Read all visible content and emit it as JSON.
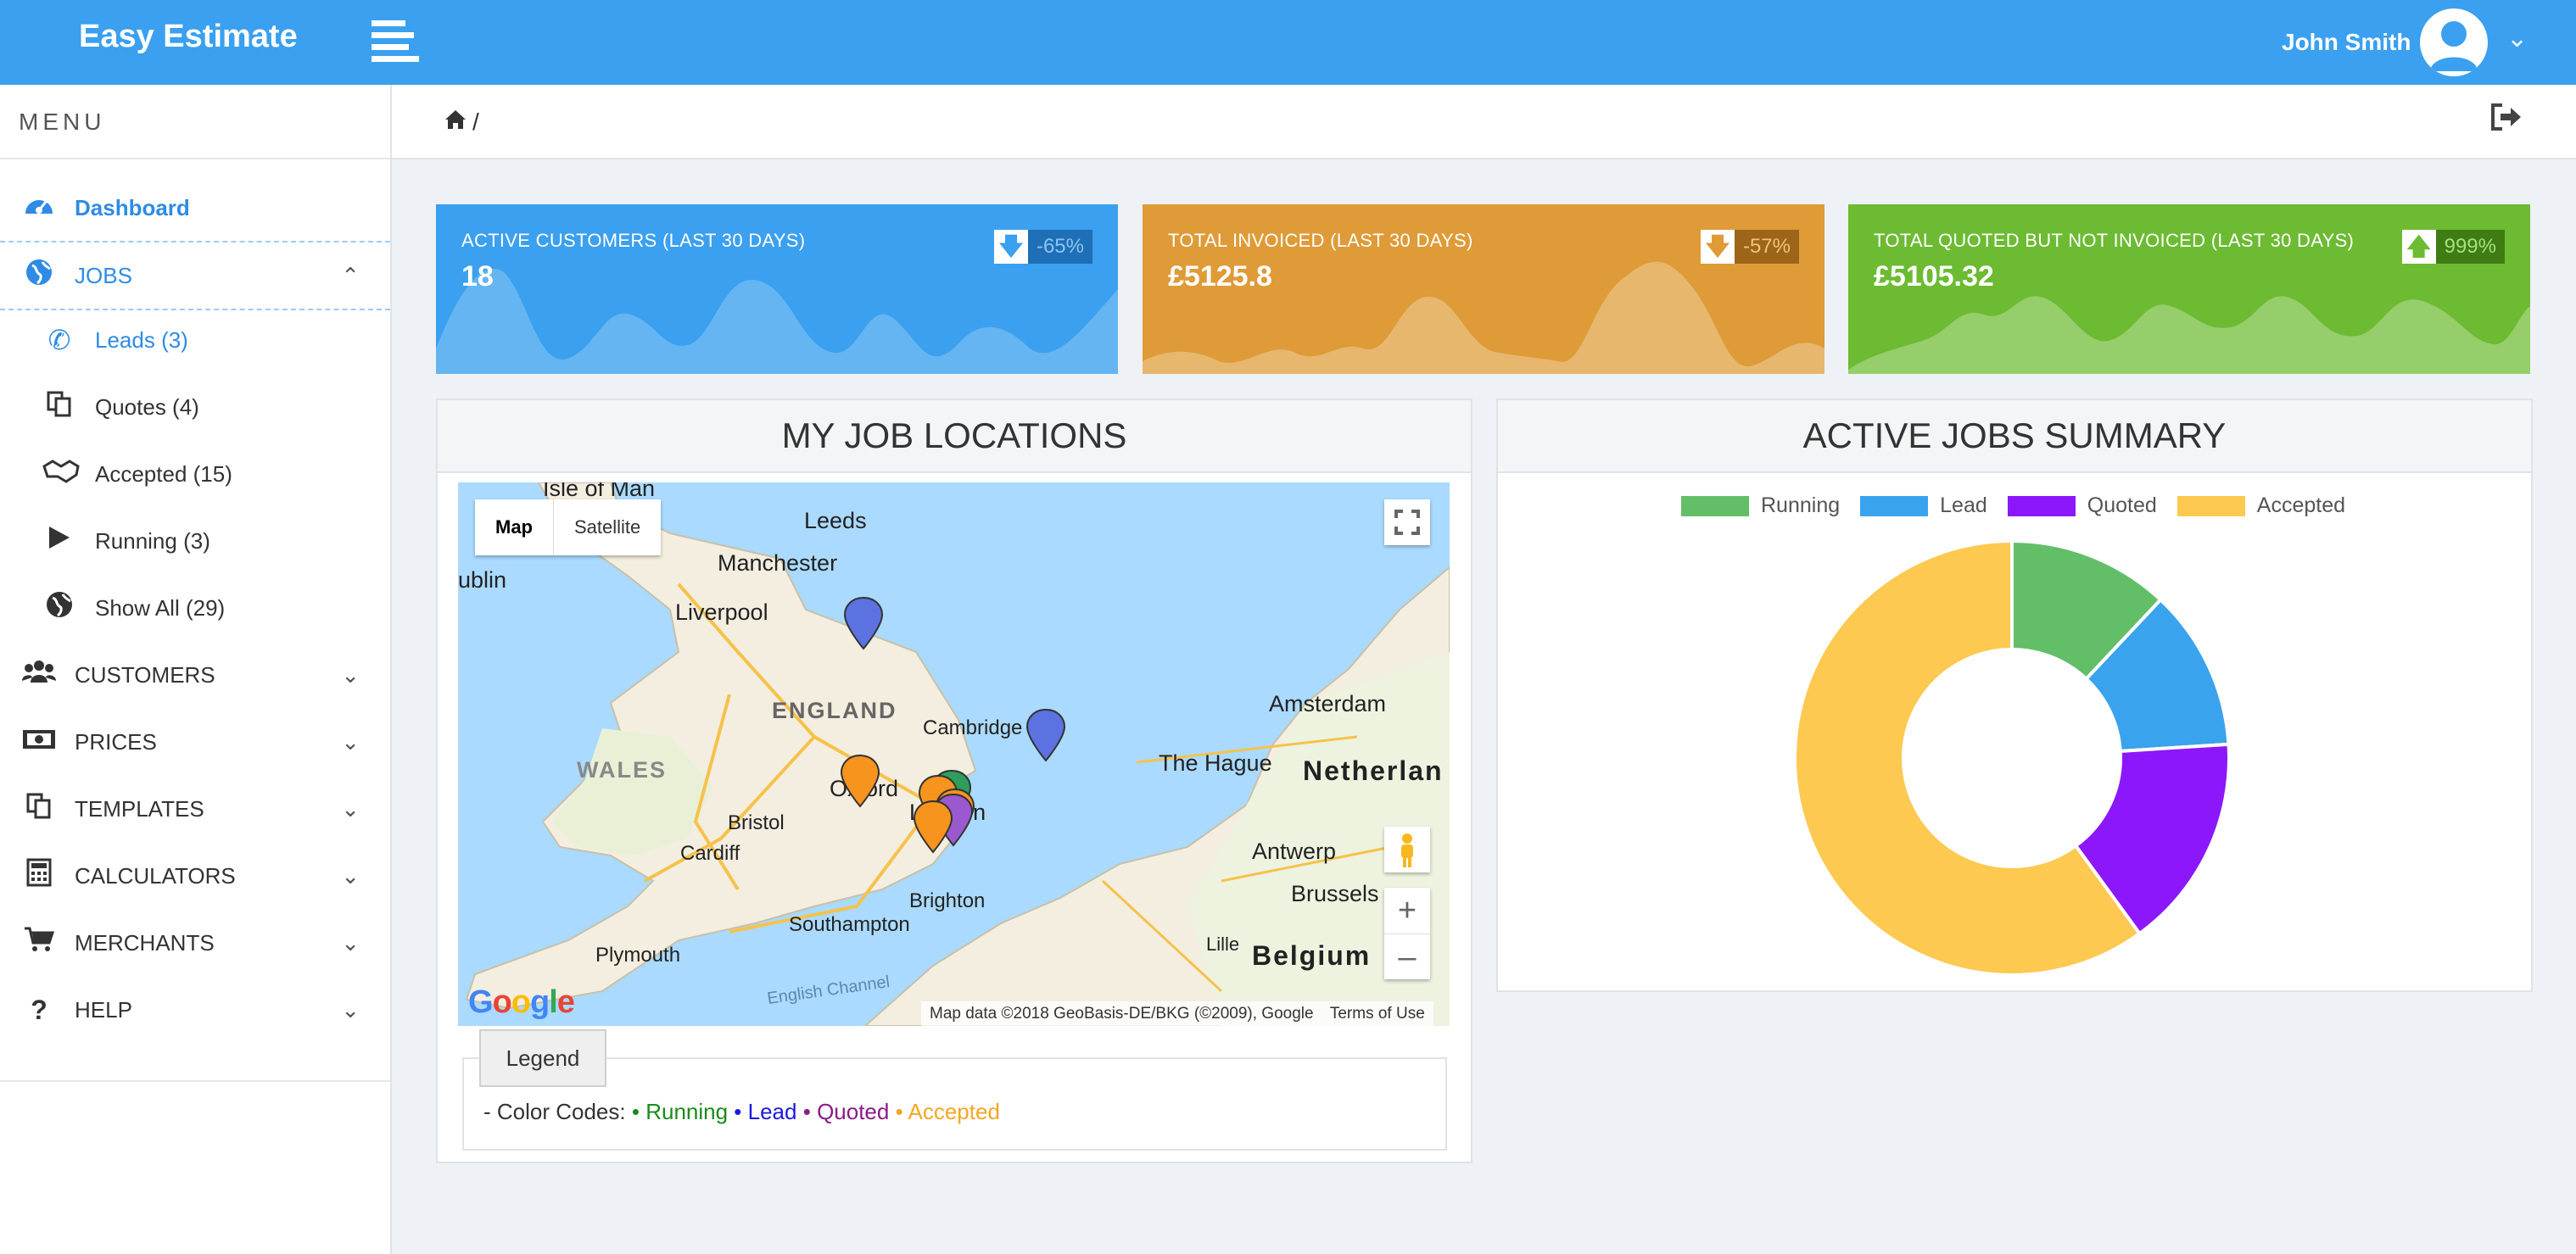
{
  "app": {
    "title": "Easy Estimate",
    "user": "John Smith"
  },
  "sidebar": {
    "menu_title": "MENU",
    "items": [
      {
        "label": "Dashboard",
        "icon": "dashboard-icon"
      },
      {
        "label": "JOBS",
        "icon": "globe-icon"
      },
      {
        "label": "Leads (3)",
        "icon": "phone-icon"
      },
      {
        "label": "Quotes (4)",
        "icon": "copy-icon"
      },
      {
        "label": "Accepted (15)",
        "icon": "handshake-icon"
      },
      {
        "label": "Running (3)",
        "icon": "play-icon"
      },
      {
        "label": "Show All (29)",
        "icon": "globe-icon"
      },
      {
        "label": "CUSTOMERS",
        "icon": "users-icon"
      },
      {
        "label": "PRICES",
        "icon": "money-icon"
      },
      {
        "label": "TEMPLATES",
        "icon": "copy-icon"
      },
      {
        "label": "CALCULATORS",
        "icon": "calculator-icon"
      },
      {
        "label": "MERCHANTS",
        "icon": "cart-icon"
      },
      {
        "label": "HELP",
        "icon": "question-icon"
      }
    ]
  },
  "breadcrumb": {
    "separator": "/"
  },
  "cards": [
    {
      "label": "ACTIVE CUSTOMERS (LAST 30 DAYS)",
      "value": "18",
      "change": "-65%",
      "direction": "down",
      "color": "#3aa0ef"
    },
    {
      "label": "TOTAL INVOICED (LAST 30 DAYS)",
      "value": "£5125.8",
      "change": "-57%",
      "direction": "down",
      "color": "#de9b37"
    },
    {
      "label": "TOTAL QUOTED BUT NOT INVOICED (LAST 30 DAYS)",
      "value": "£5105.32",
      "change": "999%",
      "direction": "up",
      "color": "#6cbb32"
    }
  ],
  "map_panel": {
    "title": "MY JOB LOCATIONS",
    "map_button": "Map",
    "satellite_button": "Satellite",
    "places": {
      "isle_of_man": "Isle of Man",
      "leeds": "Leeds",
      "manchester": "Manchester",
      "liverpool": "Liverpool",
      "dublin": "ublin",
      "england": "ENGLAND",
      "wales": "WALES",
      "cambridge": "Cambridge",
      "oxford": "Oxford",
      "bristol": "Bristol",
      "cardiff": "Cardiff",
      "london": "London",
      "brighton": "Brighton",
      "southampton": "Southampton",
      "plymouth": "Plymouth",
      "english_channel": "English Channel",
      "amsterdam": "Amsterdam",
      "the_hague": "The Hague",
      "netherlands": "Netherlan",
      "antwerp": "Antwerp",
      "brussels": "Brussels",
      "lille": "Lille",
      "belgium": "Belgium"
    },
    "google_logo": "Google",
    "attribution": "Map data ©2018 GeoBasis-DE/BKG (©2009), Google",
    "terms": "Terms of Use",
    "legend_button": "Legend",
    "color_codes_prefix": "- Color Codes:",
    "codes": [
      {
        "label": "Running",
        "color": "#1a8a1a"
      },
      {
        "label": "Lead",
        "color": "#1a1adb"
      },
      {
        "label": "Quoted",
        "color": "#8a1a8a"
      },
      {
        "label": "Accepted",
        "color": "#f5a623"
      }
    ]
  },
  "chart_panel": {
    "title": "ACTIVE JOBS SUMMARY"
  },
  "chart_data": {
    "type": "pie",
    "donut": true,
    "categories": [
      "Running",
      "Lead",
      "Quoted",
      "Accepted"
    ],
    "values": [
      3,
      3,
      4,
      15
    ],
    "colors": [
      "#63bf67",
      "#3aa3ed",
      "#8c17fb",
      "#fec951"
    ],
    "legend": "top"
  }
}
